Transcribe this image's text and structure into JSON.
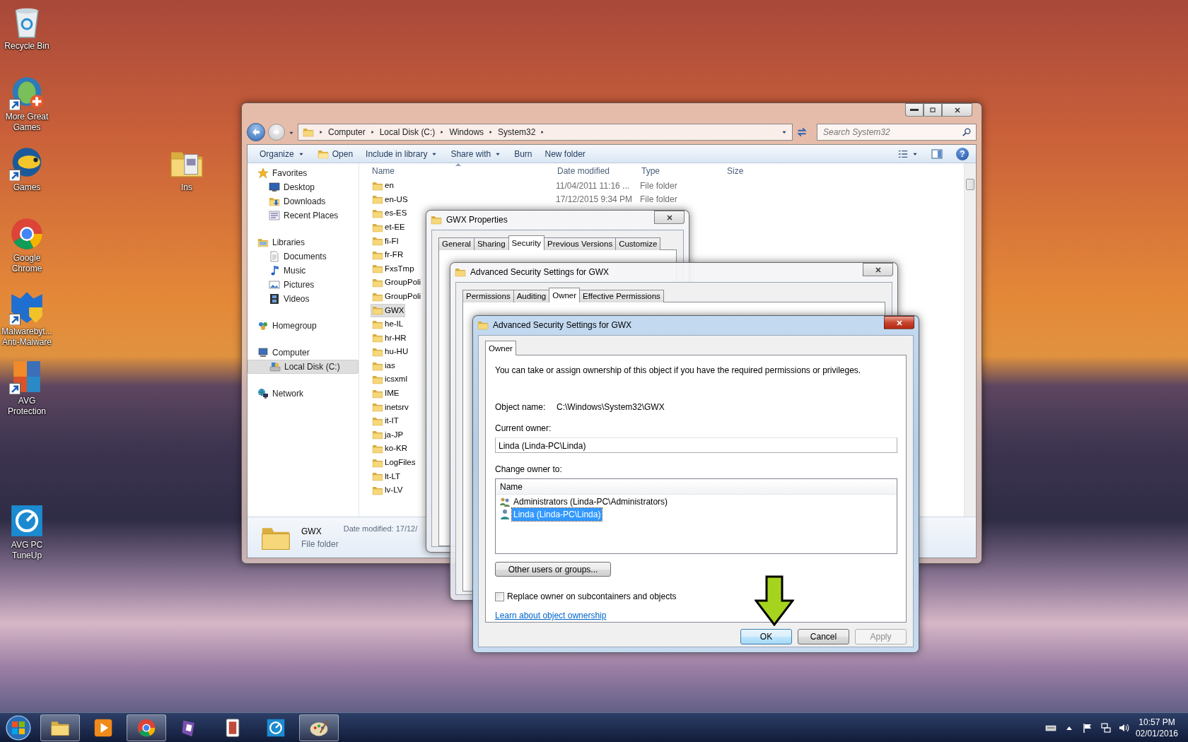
{
  "desktop_icons": [
    {
      "label": "Recycle Bin",
      "kind": "recycle"
    },
    {
      "label": "More Great Games",
      "kind": "fish"
    },
    {
      "label": "Games",
      "kind": "bigfish"
    },
    {
      "label": "Google Chrome",
      "kind": "chrome"
    },
    {
      "label": "Malwarebyt... Anti-Malware",
      "kind": "shield"
    },
    {
      "label": "AVG Protection",
      "kind": "avg"
    },
    {
      "label": "AVG PC TuneUp",
      "kind": "tuneup"
    },
    {
      "label": "Ins",
      "kind": "docfolder"
    }
  ],
  "explorer": {
    "address": [
      "Computer",
      "Local Disk (C:)",
      "Windows",
      "System32"
    ],
    "search": {
      "placeholder": "Search System32"
    },
    "toolbar": [
      {
        "label": "Organize",
        "kind": "menu"
      },
      {
        "label": "Open",
        "kind": "open"
      },
      {
        "label": "Include in library",
        "kind": "menu"
      },
      {
        "label": "Share with",
        "kind": "menu"
      },
      {
        "label": "Burn",
        "kind": "plain"
      },
      {
        "label": "New folder",
        "kind": "plain"
      }
    ],
    "help": "?",
    "nav": [
      {
        "label": "Favorites",
        "kind": "star",
        "selected": false,
        "children": [
          {
            "label": "Desktop",
            "kind": "desktop",
            "selected": false
          },
          {
            "label": "Downloads",
            "kind": "downloads",
            "selected": false
          },
          {
            "label": "Recent Places",
            "kind": "recent",
            "selected": false
          }
        ]
      },
      {
        "label": "Libraries",
        "kind": "libraries",
        "selected": false,
        "children": [
          {
            "label": "Documents",
            "kind": "documents",
            "selected": false
          },
          {
            "label": "Music",
            "kind": "music",
            "selected": false
          },
          {
            "label": "Pictures",
            "kind": "pictures",
            "selected": false
          },
          {
            "label": "Videos",
            "kind": "videos",
            "selected": false
          }
        ]
      },
      {
        "label": "Homegroup",
        "kind": "homegroup",
        "selected": false
      },
      {
        "label": "Computer",
        "kind": "computer",
        "selected": false,
        "children": [
          {
            "label": "Local Disk (C:)",
            "kind": "disk",
            "selected": true
          }
        ]
      },
      {
        "label": "Network",
        "kind": "network",
        "selected": false
      }
    ],
    "columns": [
      "Name",
      "Date modified",
      "Type",
      "Size"
    ],
    "rows": [
      {
        "name": "en",
        "date": "11/04/2011 11:16 ...",
        "type": "File folder",
        "selected": false
      },
      {
        "name": "en-US",
        "date": "17/12/2015 9:34 PM",
        "type": "File folder",
        "selected": false
      },
      {
        "name": "es-ES",
        "selected": false
      },
      {
        "name": "et-EE",
        "selected": false
      },
      {
        "name": "fi-FI",
        "selected": false
      },
      {
        "name": "fr-FR",
        "selected": false
      },
      {
        "name": "FxsTmp",
        "selected": false
      },
      {
        "name": "GroupPoli",
        "selected": false
      },
      {
        "name": "GroupPoli",
        "selected": false
      },
      {
        "name": "GWX",
        "selected": true
      },
      {
        "name": "he-IL",
        "selected": false
      },
      {
        "name": "hr-HR",
        "selected": false
      },
      {
        "name": "hu-HU",
        "selected": false
      },
      {
        "name": "ias",
        "selected": false
      },
      {
        "name": "icsxml",
        "selected": false
      },
      {
        "name": "IME",
        "selected": false
      },
      {
        "name": "inetsrv",
        "selected": false
      },
      {
        "name": "it-IT",
        "selected": false
      },
      {
        "name": "ja-JP",
        "selected": false
      },
      {
        "name": "ko-KR",
        "selected": false
      },
      {
        "name": "LogFiles",
        "selected": false
      },
      {
        "name": "lt-LT",
        "selected": false
      },
      {
        "name": "lv-LV",
        "selected": false
      }
    ],
    "details": {
      "name": "GWX",
      "type": "File folder",
      "date": "Date modified: 17/12/"
    }
  },
  "properties_dialog": {
    "title": "GWX Properties",
    "tabs": [
      {
        "label": "General",
        "selected": false
      },
      {
        "label": "Sharing",
        "selected": false
      },
      {
        "label": "Security",
        "selected": true
      },
      {
        "label": "Previous Versions",
        "selected": false
      },
      {
        "label": "Customize",
        "selected": false
      }
    ]
  },
  "advanced_dialog_back": {
    "title": "Advanced Security Settings for GWX",
    "tabs": [
      {
        "label": "Permissions",
        "selected": false
      },
      {
        "label": "Auditing",
        "selected": false
      },
      {
        "label": "Owner",
        "selected": true
      },
      {
        "label": "Effective Permissions",
        "selected": false
      }
    ]
  },
  "advanced_dialog": {
    "title": "Advanced Security Settings for GWX",
    "tabs": [
      {
        "label": "Owner",
        "selected": true
      }
    ],
    "intro": "You can take or assign ownership of this object if you have the required permissions or privileges.",
    "object_name_label": "Object name:",
    "object_name": "C:\\Windows\\System32\\GWX",
    "current_owner_label": "Current owner:",
    "current_owner": "Linda (Linda-PC\\Linda)",
    "change_owner_label": "Change owner to:",
    "list_column": "Name",
    "owners": [
      {
        "name": "Administrators (Linda-PC\\Administrators)",
        "kind": "group",
        "selected": false
      },
      {
        "name": "Linda (Linda-PC\\Linda)",
        "kind": "user",
        "selected": true
      }
    ],
    "other_button": "Other users or groups...",
    "replace": {
      "label": "Replace owner on subcontainers and objects",
      "checked": false
    },
    "link": "Learn about object ownership",
    "buttons": [
      {
        "label": "OK",
        "default": true,
        "disabled": false
      },
      {
        "label": "Cancel",
        "default": false,
        "disabled": false
      },
      {
        "label": "Apply",
        "default": false,
        "disabled": true
      }
    ]
  },
  "taskbar": {
    "apps": [
      {
        "kind": "explorer",
        "running": true
      },
      {
        "kind": "media",
        "running": false
      },
      {
        "kind": "chrome",
        "running": true
      },
      {
        "kind": "game",
        "running": false
      },
      {
        "kind": "cards",
        "running": false
      },
      {
        "kind": "tuneup",
        "running": false
      },
      {
        "kind": "paint",
        "running": true
      }
    ],
    "clock": {
      "time": "10:57 PM",
      "date": "02/01/2016"
    }
  }
}
